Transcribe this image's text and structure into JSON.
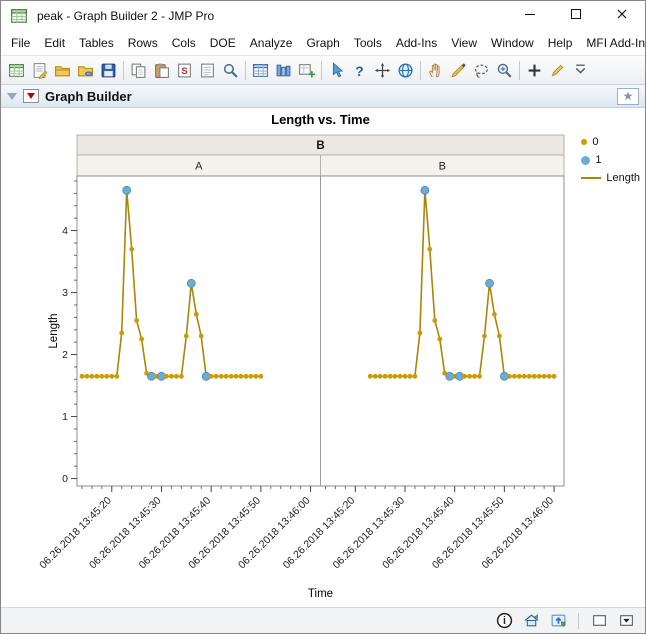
{
  "window": {
    "title": "peak - Graph Builder 2 - JMP Pro",
    "controls": [
      "minimize",
      "maximize",
      "close"
    ]
  },
  "menu_bar": {
    "items": [
      "File",
      "Edit",
      "Tables",
      "Rows",
      "Cols",
      "DOE",
      "Analyze",
      "Graph",
      "Tools",
      "Add-Ins",
      "View",
      "Window",
      "Help",
      "MFI Add-Ins"
    ]
  },
  "toolbar": {
    "icons": [
      "new-data-table",
      "new-journal",
      "open",
      "open-database",
      "save",
      "sep",
      "copy",
      "paste",
      "script-window",
      "journal-window",
      "search",
      "sep",
      "data-table-window",
      "column-info",
      "add-graph",
      "sep",
      "arrow-tool",
      "help-tool",
      "move-tool",
      "web-tool",
      "sep",
      "grabber-tool",
      "brush-tool",
      "lasso-tool",
      "magnifier-tool",
      "sep",
      "annotate-tool",
      "line-tool",
      "overflow"
    ]
  },
  "outline": {
    "title": "Graph Builder"
  },
  "legend": {
    "items": [
      {
        "label": "0",
        "swatch": "dot-small",
        "color": "#cf9a00"
      },
      {
        "label": "1",
        "swatch": "dot-large",
        "color": "#6cabd7"
      },
      {
        "label": "Length",
        "swatch": "line",
        "color": "#a8860a"
      }
    ]
  },
  "chart_data": {
    "type": "line",
    "title": "Length vs. Time",
    "xlabel": "Time",
    "ylabel": "Length",
    "group_header": "B",
    "x_tick_prefix": "06.26.2018",
    "x_ticks": [
      {
        "t": 20,
        "label": "13:45:20"
      },
      {
        "t": 30,
        "label": "13:45:30"
      },
      {
        "t": 40,
        "label": "13:45:40"
      },
      {
        "t": 50,
        "label": "13:45:50"
      },
      {
        "t": 60,
        "label": "13:46:00"
      }
    ],
    "x_minor_step": 2,
    "x_range": [
      13,
      62
    ],
    "y_ticks": [
      0,
      1,
      2,
      3,
      4
    ],
    "y_minor_step": 0.2,
    "ylim": [
      -0.12,
      4.88
    ],
    "series_name": "Length",
    "colors": {
      "line": "#a8860a",
      "group0": "#cf9a00",
      "group1": "#6cabd7",
      "group1_stroke": "#4e88b4"
    },
    "panels": [
      {
        "label": "A",
        "points": [
          [
            14,
            1.65,
            0
          ],
          [
            15,
            1.65,
            0
          ],
          [
            16,
            1.65,
            0
          ],
          [
            17,
            1.65,
            0
          ],
          [
            18,
            1.65,
            0
          ],
          [
            19,
            1.65,
            0
          ],
          [
            20,
            1.65,
            0
          ],
          [
            21,
            1.65,
            0
          ],
          [
            22,
            2.35,
            0
          ],
          [
            23,
            4.65,
            1
          ],
          [
            24,
            3.7,
            0
          ],
          [
            25,
            2.55,
            0
          ],
          [
            26,
            2.25,
            0
          ],
          [
            27,
            1.7,
            0
          ],
          [
            28,
            1.65,
            1
          ],
          [
            29,
            1.65,
            0
          ],
          [
            30,
            1.65,
            1
          ],
          [
            31,
            1.65,
            0
          ],
          [
            32,
            1.65,
            0
          ],
          [
            33,
            1.65,
            0
          ],
          [
            34,
            1.65,
            0
          ],
          [
            35,
            2.3,
            0
          ],
          [
            36,
            3.15,
            1
          ],
          [
            37,
            2.65,
            0
          ],
          [
            38,
            2.3,
            0
          ],
          [
            39,
            1.65,
            1
          ],
          [
            40,
            1.65,
            0
          ],
          [
            41,
            1.65,
            0
          ],
          [
            42,
            1.65,
            0
          ],
          [
            43,
            1.65,
            0
          ],
          [
            44,
            1.65,
            0
          ],
          [
            45,
            1.65,
            0
          ],
          [
            46,
            1.65,
            0
          ],
          [
            47,
            1.65,
            0
          ],
          [
            48,
            1.65,
            0
          ],
          [
            49,
            1.65,
            0
          ],
          [
            50,
            1.65,
            0
          ]
        ]
      },
      {
        "label": "B",
        "points": [
          [
            23,
            1.65,
            0
          ],
          [
            24,
            1.65,
            0
          ],
          [
            25,
            1.65,
            0
          ],
          [
            26,
            1.65,
            0
          ],
          [
            27,
            1.65,
            0
          ],
          [
            28,
            1.65,
            0
          ],
          [
            29,
            1.65,
            0
          ],
          [
            30,
            1.65,
            0
          ],
          [
            31,
            1.65,
            0
          ],
          [
            32,
            1.65,
            0
          ],
          [
            33,
            2.35,
            0
          ],
          [
            34,
            4.65,
            1
          ],
          [
            35,
            3.7,
            0
          ],
          [
            36,
            2.55,
            0
          ],
          [
            37,
            2.25,
            0
          ],
          [
            38,
            1.7,
            0
          ],
          [
            39,
            1.65,
            1
          ],
          [
            40,
            1.65,
            0
          ],
          [
            41,
            1.65,
            1
          ],
          [
            42,
            1.65,
            0
          ],
          [
            43,
            1.65,
            0
          ],
          [
            44,
            1.65,
            0
          ],
          [
            45,
            1.65,
            0
          ],
          [
            46,
            2.3,
            0
          ],
          [
            47,
            3.15,
            1
          ],
          [
            48,
            2.65,
            0
          ],
          [
            49,
            2.3,
            0
          ],
          [
            50,
            1.65,
            1
          ],
          [
            51,
            1.65,
            0
          ],
          [
            52,
            1.65,
            0
          ],
          [
            53,
            1.65,
            0
          ],
          [
            54,
            1.65,
            0
          ],
          [
            55,
            1.65,
            0
          ],
          [
            56,
            1.65,
            0
          ],
          [
            57,
            1.65,
            0
          ],
          [
            58,
            1.65,
            0
          ],
          [
            59,
            1.65,
            0
          ],
          [
            60,
            1.65,
            0
          ]
        ]
      }
    ]
  },
  "statusbar": {
    "icons": [
      "info",
      "home-sync",
      "update-shield",
      "sep",
      "window-box",
      "window-caret"
    ]
  }
}
